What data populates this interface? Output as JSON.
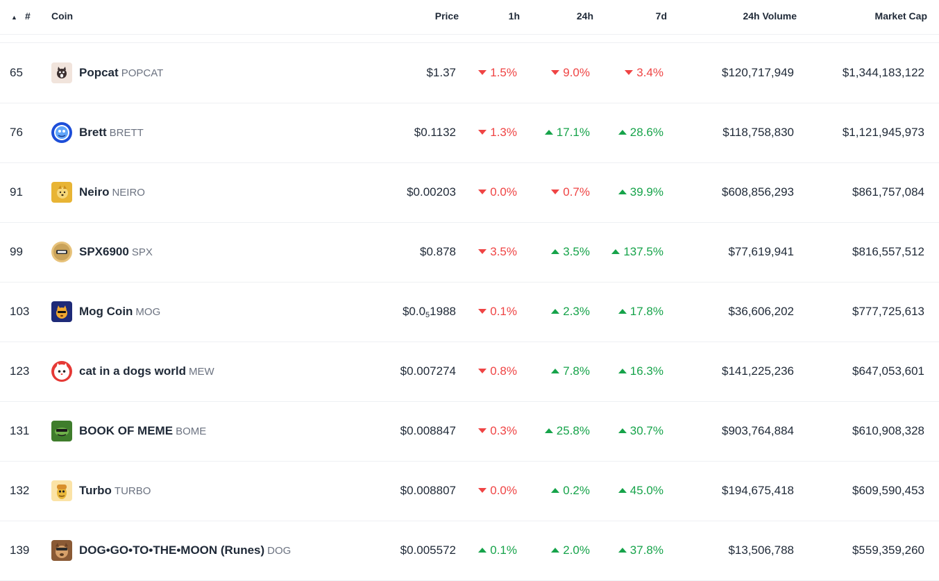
{
  "header": {
    "sort_indicator": "▲",
    "rank": "#",
    "coin": "Coin",
    "price": "Price",
    "h1": "1h",
    "h24": "24h",
    "d7": "7d",
    "volume": "24h Volume",
    "market_cap": "Market Cap"
  },
  "colors": {
    "up": "#16a34a",
    "down": "#ef4444"
  },
  "rows": [
    {
      "rank": "65",
      "name": "Popcat",
      "symbol": "POPCAT",
      "icon": "popcat-icon",
      "price": "$1.37",
      "h1": "1.5%",
      "h1_dir": "down",
      "h24": "9.0%",
      "h24_dir": "down",
      "d7": "3.4%",
      "d7_dir": "down",
      "volume": "$120,717,949",
      "market_cap": "$1,344,183,122"
    },
    {
      "rank": "76",
      "name": "Brett",
      "symbol": "BRETT",
      "icon": "brett-icon",
      "price": "$0.1132",
      "h1": "1.3%",
      "h1_dir": "down",
      "h24": "17.1%",
      "h24_dir": "up",
      "d7": "28.6%",
      "d7_dir": "up",
      "volume": "$118,758,830",
      "market_cap": "$1,121,945,973"
    },
    {
      "rank": "91",
      "name": "Neiro",
      "symbol": "NEIRO",
      "icon": "neiro-icon",
      "price": "$0.00203",
      "h1": "0.0%",
      "h1_dir": "down",
      "h24": "0.7%",
      "h24_dir": "down",
      "d7": "39.9%",
      "d7_dir": "up",
      "volume": "$608,856,293",
      "market_cap": "$861,757,084"
    },
    {
      "rank": "99",
      "name": "SPX6900",
      "symbol": "SPX",
      "icon": "spx-icon",
      "price": "$0.878",
      "h1": "3.5%",
      "h1_dir": "down",
      "h24": "3.5%",
      "h24_dir": "up",
      "d7": "137.5%",
      "d7_dir": "up",
      "volume": "$77,619,941",
      "market_cap": "$816,557,512"
    },
    {
      "rank": "103",
      "name": "Mog Coin",
      "symbol": "MOG",
      "icon": "mog-icon",
      "price": "$0.0",
      "price_sub": "5",
      "price_rest": "1988",
      "h1": "0.1%",
      "h1_dir": "down",
      "h24": "2.3%",
      "h24_dir": "up",
      "d7": "17.8%",
      "d7_dir": "up",
      "volume": "$36,606,202",
      "market_cap": "$777,725,613"
    },
    {
      "rank": "123",
      "name": "cat in a dogs world",
      "symbol": "MEW",
      "icon": "mew-icon",
      "price": "$0.007274",
      "h1": "0.8%",
      "h1_dir": "down",
      "h24": "7.8%",
      "h24_dir": "up",
      "d7": "16.3%",
      "d7_dir": "up",
      "volume": "$141,225,236",
      "market_cap": "$647,053,601"
    },
    {
      "rank": "131",
      "name": "BOOK OF MEME",
      "symbol": "BOME",
      "icon": "bome-icon",
      "price": "$0.008847",
      "h1": "0.3%",
      "h1_dir": "down",
      "h24": "25.8%",
      "h24_dir": "up",
      "d7": "30.7%",
      "d7_dir": "up",
      "volume": "$903,764,884",
      "market_cap": "$610,908,328"
    },
    {
      "rank": "132",
      "name": "Turbo",
      "symbol": "TURBO",
      "icon": "turbo-icon",
      "price": "$0.008807",
      "h1": "0.0%",
      "h1_dir": "down",
      "h24": "0.2%",
      "h24_dir": "up",
      "d7": "45.0%",
      "d7_dir": "up",
      "volume": "$194,675,418",
      "market_cap": "$609,590,453"
    },
    {
      "rank": "139",
      "name": "DOG•GO•TO•THE•MOON (Runes)",
      "symbol": "DOG",
      "icon": "dog-runes-icon",
      "price": "$0.005572",
      "h1": "0.1%",
      "h1_dir": "up",
      "h24": "2.0%",
      "h24_dir": "up",
      "d7": "37.8%",
      "d7_dir": "up",
      "volume": "$13,506,788",
      "market_cap": "$559,359,260"
    }
  ]
}
